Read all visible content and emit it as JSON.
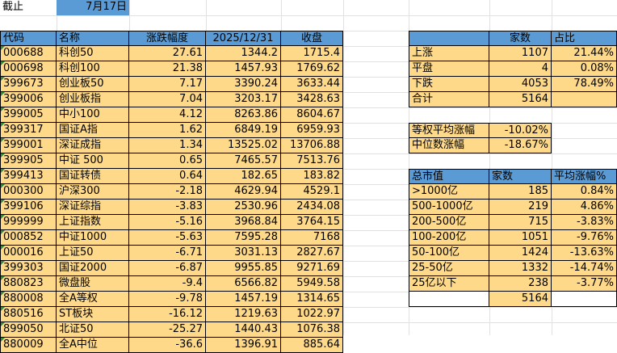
{
  "top": {
    "label": "截止",
    "date": "7月17日"
  },
  "main": {
    "headers": [
      "代码",
      "名称",
      "涨跌幅度",
      "2025/12/31",
      "收盘"
    ],
    "rows": [
      [
        "000688",
        "科创50",
        "27.61",
        "1344.2",
        "1715.4"
      ],
      [
        "000698",
        "科创100",
        "21.38",
        "1457.93",
        "1769.62"
      ],
      [
        "399673",
        "创业板50",
        "7.17",
        "3390.24",
        "3633.44"
      ],
      [
        "399006",
        "创业板指",
        "7.04",
        "3203.17",
        "3428.63"
      ],
      [
        "399005",
        "中小100",
        "4.12",
        "8263.86",
        "8604.67"
      ],
      [
        "399317",
        "国证A指",
        "1.62",
        "6849.19",
        "6959.93"
      ],
      [
        "399001",
        "深证成指",
        "1.34",
        "13525.02",
        "13706.88"
      ],
      [
        "399905",
        "中证 500",
        "0.65",
        "7465.57",
        "7513.76"
      ],
      [
        "399413",
        "国证转债",
        "0.64",
        "182.65",
        "183.82"
      ],
      [
        "000300",
        "沪深300",
        "-2.18",
        "4629.94",
        "4529.1"
      ],
      [
        "399106",
        "深证综指",
        "-3.83",
        "2530.96",
        "2434.08"
      ],
      [
        "999999",
        "上证指数",
        "-5.16",
        "3968.84",
        "3764.15"
      ],
      [
        "000852",
        "中证1000",
        "-5.63",
        "7595.28",
        "7168"
      ],
      [
        "000016",
        "上证50",
        "-6.71",
        "3031.13",
        "2827.67"
      ],
      [
        "399303",
        "国证2000",
        "-6.87",
        "9955.85",
        "9271.69"
      ],
      [
        "880823",
        "微盘股",
        "-9.4",
        "6566.82",
        "5949.58"
      ],
      [
        "880008",
        "全A等权",
        "-9.78",
        "1457.19",
        "1314.65"
      ],
      [
        "880516",
        "ST板块",
        "-16.12",
        "1219.63",
        "1022.97"
      ],
      [
        "899050",
        "北证50",
        "-25.27",
        "1440.43",
        "1076.38"
      ],
      [
        "880009",
        "全A中位",
        "-36.6",
        "1396.91",
        "885.64"
      ]
    ]
  },
  "stats": {
    "headers": [
      "",
      "家数",
      "占比"
    ],
    "rows": [
      [
        "上涨",
        "1107",
        "21.44%"
      ],
      [
        "平盘",
        "4",
        "0.08%"
      ],
      [
        "下跌",
        "4053",
        "78.49%"
      ],
      [
        "合计",
        "5164",
        ""
      ]
    ]
  },
  "avg": {
    "rows": [
      [
        "等权平均涨幅",
        "-10.02%"
      ],
      [
        "中位数涨幅",
        "-18.67%"
      ]
    ]
  },
  "cap": {
    "headers": [
      "总市值",
      "家数",
      "平均涨幅%"
    ],
    "rows": [
      [
        ">1000亿",
        "185",
        "0.84%"
      ],
      [
        "500-1000亿",
        "219",
        "4.86%"
      ],
      [
        "200-500亿",
        "715",
        "-3.83%"
      ],
      [
        "100-200亿",
        "1051",
        "-9.76%"
      ],
      [
        "50-100亿",
        "1424",
        "-13.63%"
      ],
      [
        "25-50亿",
        "1332",
        "-14.74%"
      ],
      [
        "25亿以下",
        "238",
        "-3.77%"
      ],
      [
        "",
        "5164",
        ""
      ]
    ]
  }
}
